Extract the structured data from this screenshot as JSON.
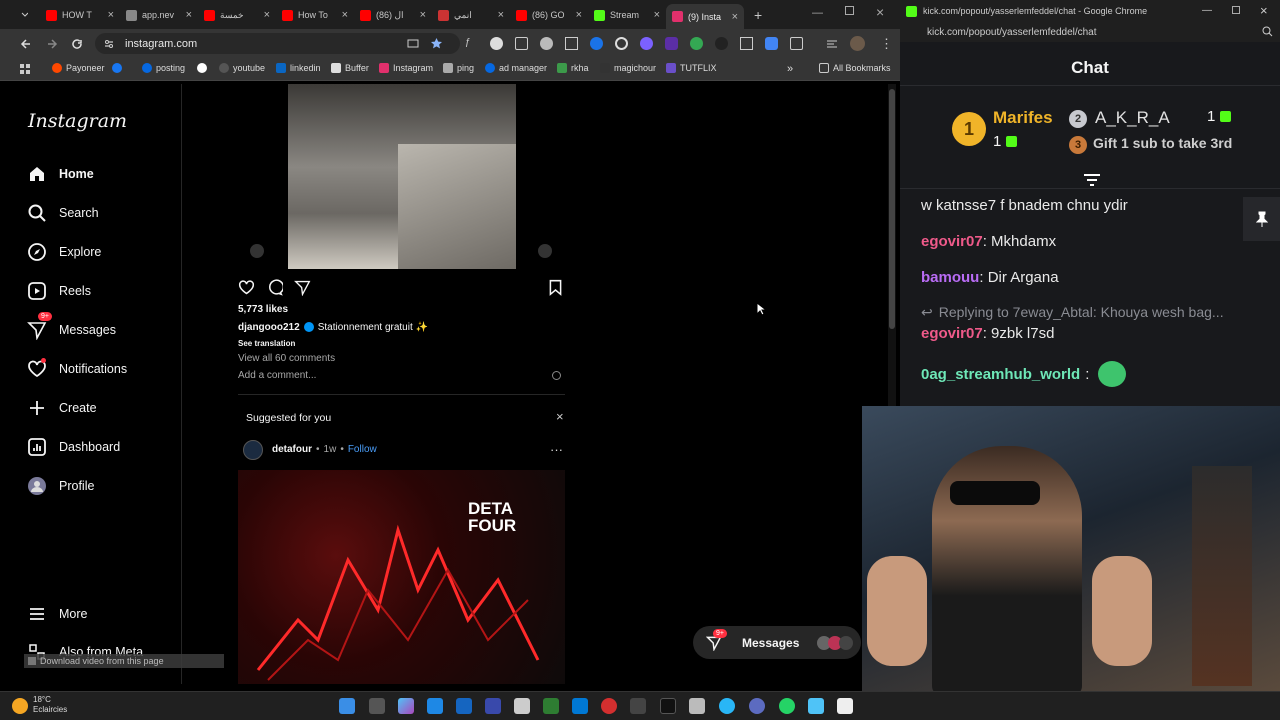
{
  "browser": {
    "tabs": [
      {
        "label": "HOW T",
        "color": "#ff0000"
      },
      {
        "label": "app.nev",
        "color": "#888888"
      },
      {
        "label": "خمسة",
        "color": "#ff0000"
      },
      {
        "label": "How To",
        "color": "#ff0000"
      },
      {
        "label": "(86) ال",
        "color": "#ff0000"
      },
      {
        "label": "انمي",
        "color": "#cc3333"
      },
      {
        "label": "(86) GO",
        "color": "#ff0000"
      },
      {
        "label": "Stream",
        "color": "#53fc18"
      },
      {
        "label": "(9) Insta",
        "color": "#e1306c"
      }
    ],
    "url": "instagram.com",
    "bookmarks": [
      "Payoneer",
      "posting",
      "youtube",
      "linkedin",
      "Buffer",
      "Instagram",
      "ping",
      "ad manager",
      "rkha",
      "magichour",
      "TUTFLIX"
    ],
    "all_bookmarks": "All Bookmarks"
  },
  "instagram": {
    "logo": "Instagram",
    "nav": [
      {
        "label": "Home",
        "icon": "home-icon"
      },
      {
        "label": "Search",
        "icon": "search-icon"
      },
      {
        "label": "Explore",
        "icon": "compass-icon"
      },
      {
        "label": "Reels",
        "icon": "reels-icon"
      },
      {
        "label": "Messages",
        "icon": "messenger-icon",
        "badge": "9+"
      },
      {
        "label": "Notifications",
        "icon": "heart-icon"
      },
      {
        "label": "Create",
        "icon": "plus-icon"
      },
      {
        "label": "Dashboard",
        "icon": "dashboard-icon"
      },
      {
        "label": "Profile",
        "icon": "avatar-icon"
      }
    ],
    "more": "More",
    "also_meta": "Also from Meta",
    "download_overlay": "Download video from this page",
    "post": {
      "likes": "5,773 likes",
      "author": "djangooo212",
      "caption": "Stationnement gratuit ✨",
      "see_translation": "See translation",
      "comments": "View all 60 comments",
      "add_comment": "Add a comment..."
    },
    "suggested": {
      "heading": "Suggested for you",
      "user": "detafour",
      "age": "1w",
      "follow": "Follow",
      "image_text": "DETA FOUR"
    },
    "messages_pill": {
      "label": "Messages",
      "badge": "9+"
    }
  },
  "kick": {
    "window_title": "kick.com/popout/yasserlemfeddel/chat - Google Chrome",
    "url": "kick.com/popout/yasserlemfeddel/chat",
    "chat_title": "Chat",
    "leaderboard": [
      {
        "rank": "1",
        "name": "Marifes",
        "count": "1"
      },
      {
        "rank": "2",
        "name": "A_K_R_A",
        "count": "1"
      },
      {
        "rank": "3",
        "name": "Gift 1 sub to take 3rd",
        "count": ""
      }
    ],
    "messages": [
      {
        "user": "",
        "text": "w katnsse7 f bnadem chnu ydir",
        "color": "#eaeaea"
      },
      {
        "user": "egovir07",
        "text": "Mkhdamx",
        "color": "#ef5a8a"
      },
      {
        "user": "bamouu",
        "text": "Dir Argana",
        "color": "#b96cf5"
      },
      {
        "user": "egovir07",
        "text": "9zbk l7sd",
        "color": "#ef5a8a",
        "reply": "Replying to 7eway_Abtal: Khouya wesh bag..."
      },
      {
        "user": "0ag_streamhub_world",
        "text": "",
        "color": "#6ee7b7"
      }
    ]
  },
  "taskbar": {
    "temp": "18°C",
    "weather": "Eclaircies"
  }
}
